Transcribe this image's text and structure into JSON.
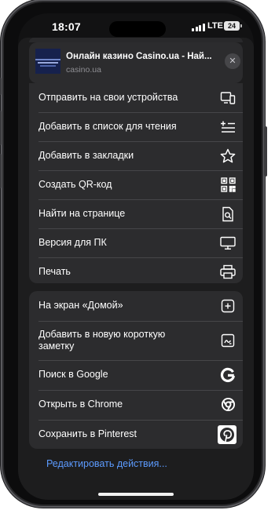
{
  "status_bar": {
    "time": "18:07",
    "network": "LTE",
    "battery_level": "24"
  },
  "page": {
    "title": "Онлайн казино Casino.ua - Най...",
    "url": "casino.ua",
    "close_icon": "close-icon"
  },
  "actions_group_1": [
    {
      "label": "Отправить на свои устройства",
      "icon": "send-to-devices-icon"
    },
    {
      "label": "Добавить в список для чтения",
      "icon": "reading-list-icon"
    },
    {
      "label": "Добавить в закладки",
      "icon": "star-icon"
    },
    {
      "label": "Создать QR-код",
      "icon": "qr-code-icon"
    },
    {
      "label": "Найти на странице",
      "icon": "find-in-page-icon"
    },
    {
      "label": "Версия для ПК",
      "icon": "desktop-icon"
    },
    {
      "label": "Печать",
      "icon": "printer-icon"
    }
  ],
  "actions_group_2": [
    {
      "label": "На экран «Домой»",
      "icon": "add-to-home-icon"
    },
    {
      "label": "Добавить в новую короткую заметку",
      "icon": "quick-note-icon"
    },
    {
      "label": "Поиск в Google",
      "icon": "google-icon"
    },
    {
      "label": "Открыть в Chrome",
      "icon": "chrome-icon"
    },
    {
      "label": "Сохранить в Pinterest",
      "icon": "pinterest-icon"
    }
  ],
  "edit_actions_label": "Редактировать действия...",
  "colors": {
    "sheet_background": "#1d1d1e",
    "row_background": "#2c2c2e",
    "link_blue": "#5c9bff",
    "text": "#ffffff",
    "secondary_text": "#8e8e93"
  }
}
